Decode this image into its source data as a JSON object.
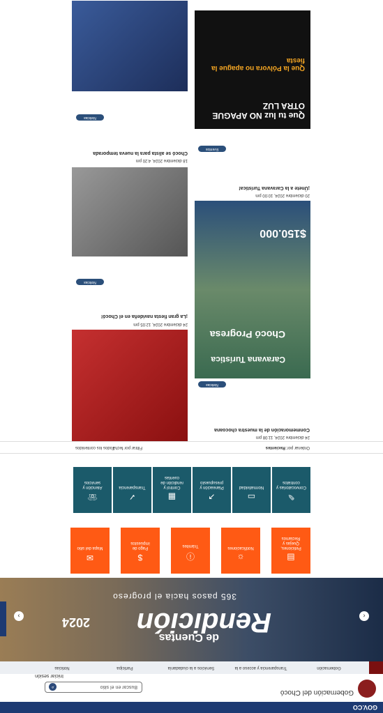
{
  "govco": {
    "label": "GOV.CO"
  },
  "header": {
    "title": "Gobernación del Chocó",
    "search_placeholder": "Buscar en el sitio",
    "login": "Iniciar sesión"
  },
  "nav": {
    "items": [
      "Gobernación",
      "Transparencia y acceso a la información",
      "Servicios a la ciudadanía",
      "Participa",
      "Noticias"
    ]
  },
  "hero": {
    "title": "Rendición",
    "subtitle": "de Cuentas",
    "tag": "2024",
    "band": "365 pasos hacia el progreso"
  },
  "orange_buttons": [
    {
      "label": "Peticiones, Quejas y Reclamos",
      "icon": "document-icon"
    },
    {
      "label": "Notificaciones",
      "icon": "bell-icon"
    },
    {
      "label": "Trámites",
      "icon": "alert-icon"
    },
    {
      "label": "Pago de impuestos",
      "icon": "money-icon"
    },
    {
      "label": "Mapa del sitio",
      "icon": "map-icon"
    }
  ],
  "teal_buttons": [
    {
      "label": "Convocatorias y contratos",
      "icon": "contract-icon"
    },
    {
      "label": "Normatividad",
      "icon": "law-icon"
    },
    {
      "label": "Planeación y presupuesto",
      "icon": "chart-icon"
    },
    {
      "label": "Control y rendición de cuentas",
      "icon": "doc-icon"
    },
    {
      "label": "Transparencia",
      "icon": "check-icon"
    },
    {
      "label": "Atención y servicios",
      "icon": "support-icon"
    }
  ],
  "filters": {
    "order": "Ordenar por:",
    "recent": "Recientes",
    "date": "Filtrar por fecha",
    "all": "Todos los contenidos"
  },
  "news": [
    {
      "date": "24 diciembre 2024, 12:05 pm",
      "title": "¡La gran fiesta navideña en el Chocó!",
      "tag": "Noticias"
    },
    {
      "date": "24 diciembre 2024, 11:08 pm",
      "title": "Conmemoración de la muestra chocoana",
      "tag": "Noticias"
    },
    {
      "date": "20 diciembre 2024, 10:00 pm",
      "title": "¡Únete a la Caravana Turística!",
      "tag": "Eventos"
    },
    {
      "date": "18 diciembre 2024, 4:20 pm",
      "title": "Chocó se alista para la nueva temporada",
      "tag": "Noticias"
    }
  ],
  "promo": {
    "caravana": "Caravana Turística",
    "progresa": "Chocó Progresa",
    "price": "$150.000",
    "luz": "Que tu luz NO APAGUE OTRA LUZ",
    "polvora": "Que la Pólvora no apague la fiesta"
  }
}
